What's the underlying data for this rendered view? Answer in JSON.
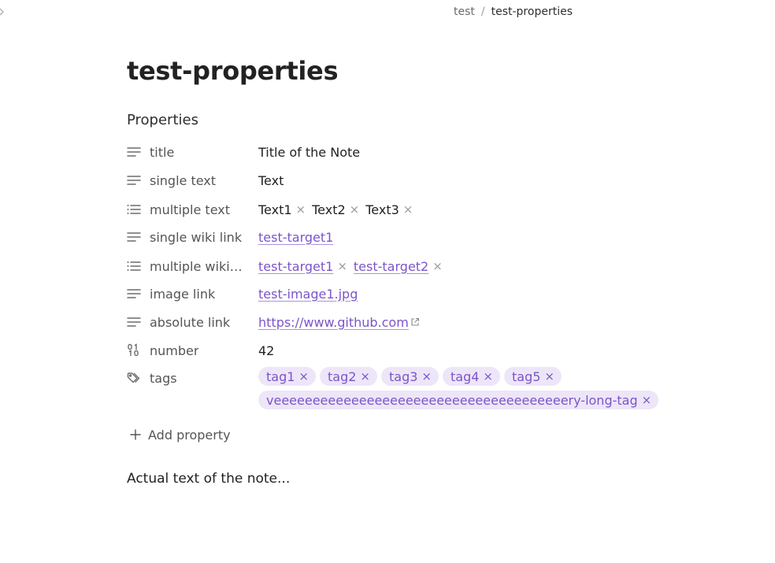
{
  "breadcrumb": {
    "parent": "test",
    "separator": "/",
    "current": "test-properties"
  },
  "note": {
    "title": "test-properties",
    "body": "Actual text of the note..."
  },
  "properties": {
    "heading": "Properties",
    "add_label": "Add property",
    "rows": {
      "title": {
        "name": "title",
        "icon": "text-lines-icon",
        "value": "Title of the Note"
      },
      "single_text": {
        "name": "single text",
        "icon": "text-lines-icon",
        "value": "Text"
      },
      "multiple_text": {
        "name": "multiple text",
        "icon": "list-icon",
        "values": [
          "Text1",
          "Text2",
          "Text3"
        ]
      },
      "single_wiki_link": {
        "name": "single wiki link",
        "icon": "text-lines-icon",
        "value": "test-target1"
      },
      "multiple_wiki_links": {
        "name": "multiple wiki li...",
        "icon": "list-icon",
        "values": [
          "test-target1",
          "test-target2"
        ]
      },
      "image_link": {
        "name": "image link",
        "icon": "text-lines-icon",
        "value": "test-image1.jpg"
      },
      "absolute_link": {
        "name": "absolute link",
        "icon": "text-lines-icon",
        "value": "https://www.github.com"
      },
      "number": {
        "name": "number",
        "icon": "number-icon",
        "value": "42"
      },
      "tags": {
        "name": "tags",
        "icon": "tags-icon",
        "values": [
          "tag1",
          "tag2",
          "tag3",
          "tag4",
          "tag5",
          "veeeeeeeeeeeeeeeeeeeeeeeeeeeeeeeeeeeeeery-long-tag"
        ]
      }
    }
  },
  "ui": {
    "remove_glyph": "×",
    "collapse_icon": "chevron-right-icon"
  },
  "colors": {
    "accent": "#7b55c9",
    "tag_bg": "#ede6f8",
    "muted_text": "#555555"
  }
}
